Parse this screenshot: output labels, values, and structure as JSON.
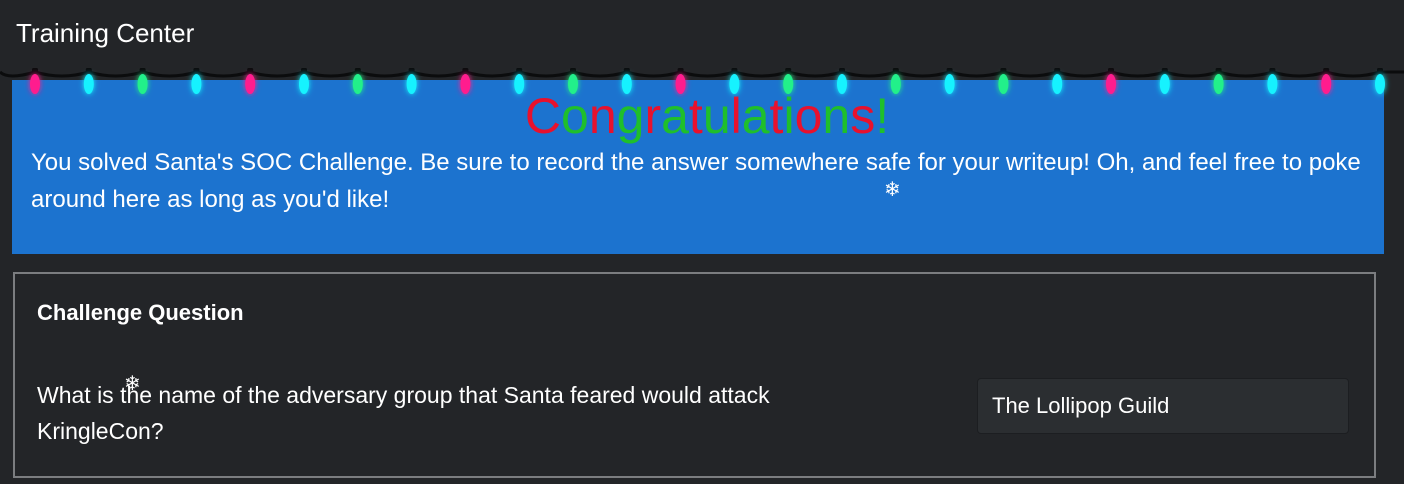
{
  "header": {
    "title": "Training Center"
  },
  "banner": {
    "congrats": "Congratulations!",
    "congrats_colors": [
      "#e8112d",
      "#1fbf2b"
    ],
    "message": "You solved Santa's SOC Challenge. Be sure to record the answer somewhere safe for your writeup! Oh, and feel free to poke around here as long as you'd like!",
    "background": "#1c73cf"
  },
  "lights": {
    "colors": [
      "#ff1f8e",
      "#15f2ff",
      "#20f08a"
    ]
  },
  "challenge": {
    "heading": "Challenge Question",
    "question": "What is the name of the adversary group that Santa feared would attack KringleCon?",
    "answer_value": "The Lollipop Guild"
  },
  "decorations": {
    "snowflake": "❄"
  }
}
